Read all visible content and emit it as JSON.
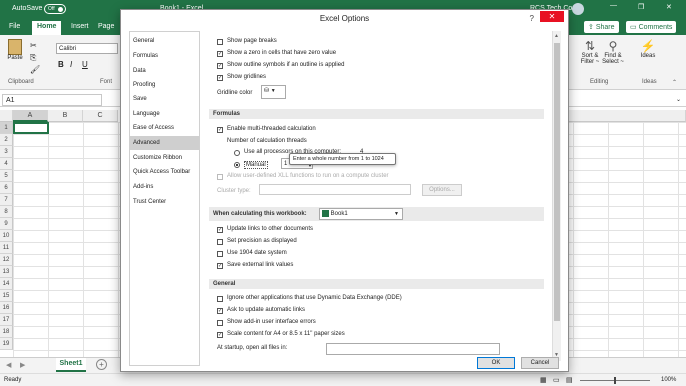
{
  "title_bar": {
    "autosave": "AutoSave",
    "toggle": "Off",
    "book": "Book1 - Excel",
    "user": "RCS Tech Co.."
  },
  "ribbon_tabs": [
    "File",
    "Home",
    "Insert",
    "Page"
  ],
  "right_tabs": {
    "share": "Share",
    "comments": "Comments"
  },
  "ribbon": {
    "font": "Calibri",
    "clipboard": "Clipboard",
    "paste": "Paste",
    "font_group": "Font",
    "bold": "B",
    "italic": "I",
    "underline": "U",
    "sort": "Sort &",
    "filter": "Filter ~",
    "find": "Find &",
    "select": "Select ~",
    "ideas": "Ideas",
    "editing": "Editing",
    "ideas_group": "Ideas"
  },
  "formula_bar": {
    "name_box": "A1"
  },
  "columns": [
    "A",
    "B",
    "C"
  ],
  "rows": [
    "1",
    "2",
    "3",
    "4",
    "5",
    "6",
    "7",
    "8",
    "9",
    "10",
    "11",
    "12",
    "13",
    "14",
    "15",
    "16",
    "17",
    "18",
    "19"
  ],
  "sheet": {
    "tab": "Sheet1"
  },
  "status": {
    "ready": "Ready",
    "zoom": "100%"
  },
  "dialog": {
    "title": "Excel Options",
    "help": "?",
    "close": "✕",
    "nav": [
      "General",
      "Formulas",
      "Data",
      "Proofing",
      "Save",
      "Language",
      "Ease of Access",
      "Advanced",
      "Customize Ribbon",
      "Quick Access Toolbar",
      "Add-ins",
      "Trust Center"
    ],
    "display": {
      "page_breaks": "Show page breaks",
      "zero": "Show a zero in cells that have zero value",
      "outline": "Show outline symbols if an outline is applied",
      "gridlines": "Show gridlines",
      "gridline_color": "Gridline color"
    },
    "formulas": {
      "header": "Formulas",
      "multi": "Enable multi-threaded calculation",
      "threads": "Number of calculation threads",
      "all": "Use all processors on this computer:",
      "all_count": "4",
      "manual": "Manual",
      "manual_value": "1",
      "tooltip": "Enter a whole number from 1 to 1024",
      "user_defined": "Allow user-defined XLL functions to run on a compute cluster",
      "cluster_type": "Cluster type:",
      "options": "Options..."
    },
    "workbook": {
      "header": "When calculating this workbook:",
      "book": "Book1",
      "update_links": "Update links to other documents",
      "precision": "Set precision as displayed",
      "date1904": "Use 1904 date system",
      "save_links": "Save external link values"
    },
    "general": {
      "header": "General",
      "dde": "Ignore other applications that use Dynamic Data Exchange (DDE)",
      "auto_links": "Ask to update automatic links",
      "addin_errors": "Show add-in user interface errors",
      "scale": "Scale content for A4 or 8.5 x 11\" paper sizes",
      "startup": "At startup, open all files in:"
    },
    "ok": "OK",
    "cancel": "Cancel"
  }
}
